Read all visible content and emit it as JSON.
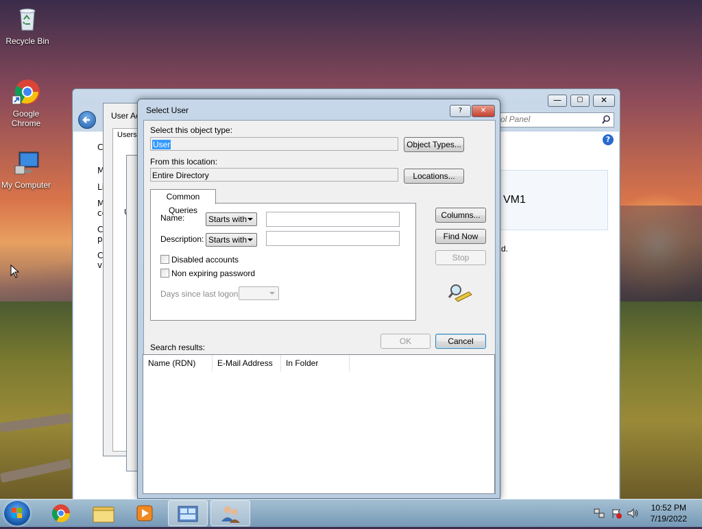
{
  "desktop": {
    "icons": [
      {
        "label": "Recycle Bin"
      },
      {
        "label": "Google Chrome"
      },
      {
        "label": "My Computer"
      }
    ]
  },
  "background_windows": {
    "control_panel": {
      "search_placeholder": "ol Panel",
      "heading_fragment": "VM1",
      "text_fragment": "d.",
      "left_letters": [
        "C",
        "M",
        "Li",
        "M",
        "ce",
        "C",
        "pi",
        "C",
        "va"
      ]
    },
    "user_accounts": {
      "title_fragment": "User Ac",
      "tab_fragment": "Users",
      "letter_fragment": "U"
    }
  },
  "dialog": {
    "title": "Select User",
    "help_btn": "?",
    "close_btn": "✕",
    "object_type_label": "Select this object type:",
    "object_type_value": "User",
    "object_types_btn": "Object Types...",
    "location_label": "From this location:",
    "location_value": "Entire Directory",
    "locations_btn": "Locations...",
    "tab_label": "Common Queries",
    "name_label": "Name:",
    "name_mode": "Starts with",
    "description_label": "Description:",
    "description_mode": "Starts with",
    "disabled_accounts": "Disabled accounts",
    "non_expiring": "Non expiring password",
    "days_since_logon": "Days since last logon:",
    "columns_btn": "Columns...",
    "find_now_btn": "Find Now",
    "stop_btn": "Stop",
    "ok_btn": "OK",
    "cancel_btn": "Cancel",
    "search_results_label": "Search results:",
    "columns": [
      "Name (RDN)",
      "E-Mail Address",
      "In Folder"
    ]
  },
  "taskbar": {
    "time": "10:52 PM",
    "date": "7/19/2022"
  }
}
